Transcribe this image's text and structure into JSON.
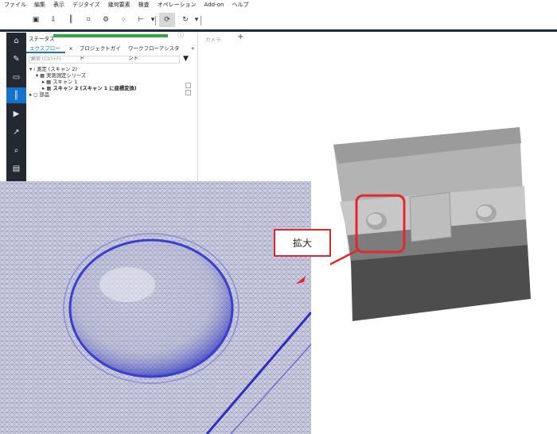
{
  "menu": [
    "ファイル",
    "編集",
    "表示",
    "デジタイズ",
    "幾何要素",
    "検査",
    "オペレーション",
    "Add-on",
    "ヘルプ"
  ],
  "panel": {
    "status_label": "ステータス",
    "tabs": [
      {
        "label": "エクスプローラ"
      },
      {
        "label": "×"
      },
      {
        "label": "プロジェクトガイド"
      },
      {
        "label": "ワークフローアシスタント"
      }
    ],
    "add_tab": "+",
    "search_placeholder": "検索 (Ctrl+F)",
    "tree": [
      "測定 (スキャン 2)",
      "実測測定シリーズ",
      "スキャン 1",
      "スキャン 2 (スキャン 1 に座標変換)",
      "部品"
    ]
  },
  "viewport": {
    "camera_label": "カメラ",
    "add": "+"
  },
  "annotation": {
    "callout": "拡大",
    "accent": "#e0282e"
  }
}
